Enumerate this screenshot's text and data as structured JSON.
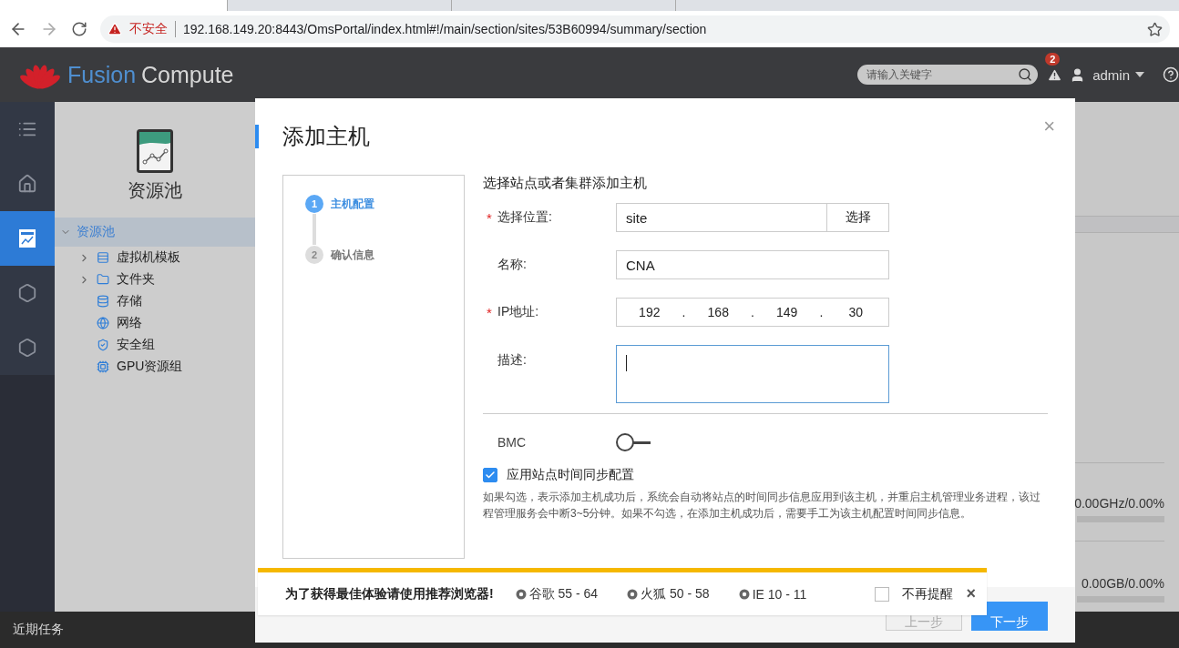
{
  "browser_tabs": [
    {
      "selected": true
    },
    {
      "selected": false
    },
    {
      "selected": false
    }
  ],
  "address_bar": {
    "security": "不安全",
    "url": "192.168.149.20:8443/OmsPortal/index.html#!/main/section/sites/53B60994/summary/section"
  },
  "header": {
    "logo": {
      "first": "Fusion",
      "second": "Compute"
    },
    "search": {
      "placeholder": "请输入关键字"
    },
    "alert_count": "2",
    "user": "admin"
  },
  "rail": [
    {
      "selected": false
    },
    {
      "selected": false
    },
    {
      "selected": true
    },
    {
      "selected": false
    },
    {
      "selected": false
    }
  ],
  "panel": {
    "title": "资源池",
    "tree": [
      {
        "label": "资源池",
        "kind": "root",
        "expanded": true,
        "selected": true,
        "children": [
          {
            "label": "虚拟机模板",
            "kind": "branch",
            "selected": false
          },
          {
            "label": "文件夹",
            "kind": "branch",
            "selected": false
          },
          {
            "label": "存储",
            "kind": "leaf",
            "selected": false
          },
          {
            "label": "网络",
            "kind": "leaf",
            "selected": false
          },
          {
            "label": "安全组",
            "kind": "leaf",
            "selected": false
          },
          {
            "label": "GPU资源组",
            "kind": "leaf",
            "selected": false
          }
        ]
      }
    ]
  },
  "background_stats": [
    {
      "reading": "0.00GHz/0.00%",
      "level": 0
    },
    {
      "reading": "0.00GB/0.00%",
      "level": 0
    }
  ],
  "recent_tasks": "近期任务",
  "dialog": {
    "title": "添加主机",
    "close": "×",
    "steps": [
      {
        "number": "1",
        "label": "主机配置",
        "selected": true
      },
      {
        "number": "2",
        "label": "确认信息",
        "selected": false
      }
    ],
    "heading": "选择站点或者集群添加主机",
    "fields": [
      {
        "kind": "picker",
        "label": "选择位置:",
        "required_mark": "*",
        "value": "site",
        "button": "选择"
      },
      {
        "kind": "text",
        "label": "名称:",
        "value": "CNA"
      },
      {
        "kind": "ip",
        "label": "IP地址:",
        "required_mark": "*",
        "octets": [
          "192",
          "168",
          "149",
          "30"
        ],
        "separator": "."
      },
      {
        "kind": "textarea",
        "label": "描述:",
        "focused": true
      }
    ],
    "bmc": {
      "label": "BMC",
      "on": false
    },
    "time_sync": {
      "label": "应用站点时间同步配置",
      "checked": true,
      "note": "如果勾选，表示添加主机成功后，系统会自动将站点的时间同步信息应用到该主机，并重启主机管理业务进程，该过程管理服务会中断3~5分钟。如果不勾选，在添加主机成功后，需要手工为该主机配置时间同步信息。"
    },
    "buttons": [
      {
        "label": "上一步",
        "disabled": true
      },
      {
        "label": "下一步",
        "disabled": false
      }
    ]
  },
  "browser_banner": {
    "message": "为了获得最佳体验请使用推荐浏览器!",
    "browsers": [
      "谷歌 55 - 64",
      "火狐 50 - 58",
      "IE 10 - 11"
    ],
    "dont_remind": {
      "label": "不再提醒",
      "checked": false
    },
    "close": "×"
  }
}
